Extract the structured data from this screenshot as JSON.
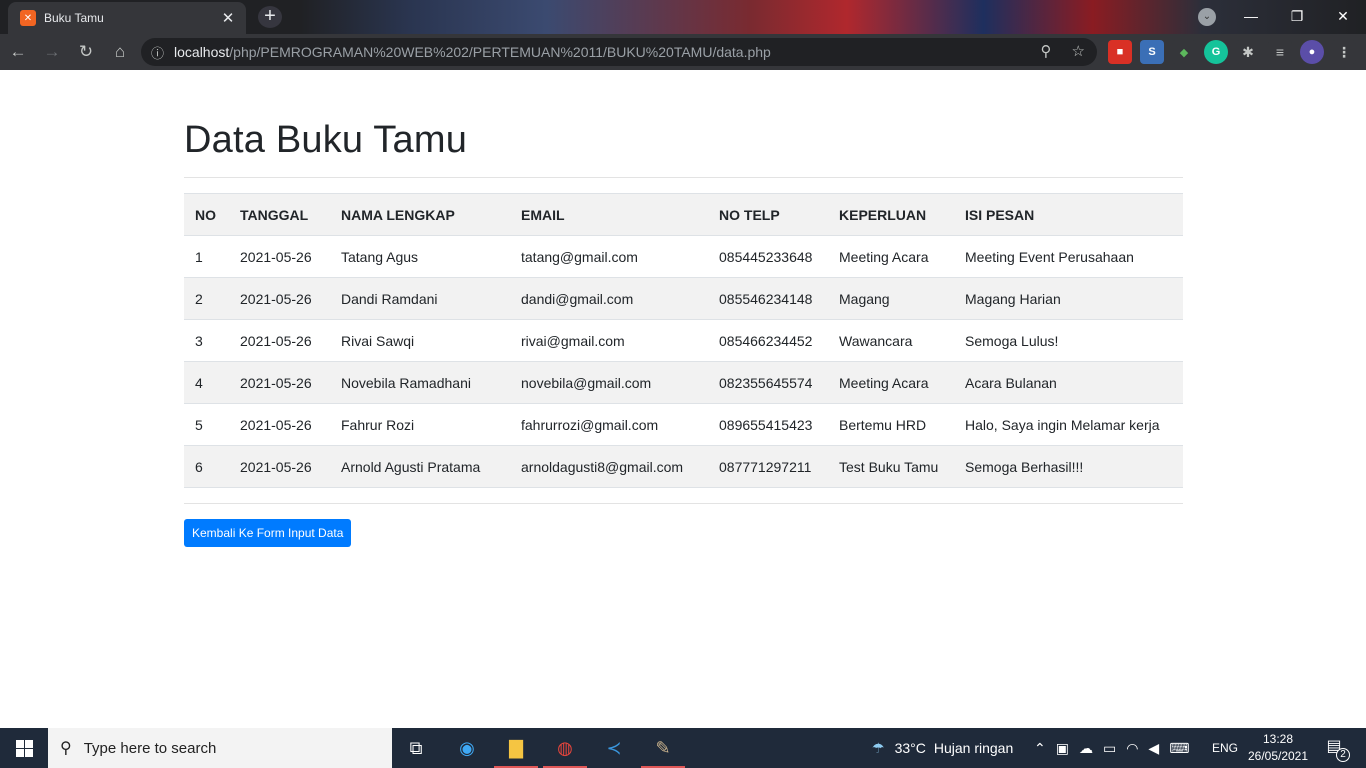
{
  "browser": {
    "tab_title": "Buku Tamu",
    "tab_close": "✕",
    "new_tab": "+",
    "url_host": "localhost",
    "url_path": "/php/PEMROGRAMAN%20WEB%202/PERTEMUAN%2011/BUKU%20TAMU/data.php",
    "window_controls": {
      "minimize": "—",
      "restore": "❐",
      "close": "✕"
    }
  },
  "page": {
    "title": "Data Buku Tamu",
    "columns": [
      "NO",
      "TANGGAL",
      "NAMA LENGKAP",
      "EMAIL",
      "NO TELP",
      "KEPERLUAN",
      "ISI PESAN"
    ],
    "rows": [
      [
        "1",
        "2021-05-26",
        "Tatang Agus",
        "tatang@gmail.com",
        "085445233648",
        "Meeting Acara",
        "Meeting Event Perusahaan"
      ],
      [
        "2",
        "2021-05-26",
        "Dandi Ramdani",
        "dandi@gmail.com",
        "085546234148",
        "Magang",
        "Magang Harian"
      ],
      [
        "3",
        "2021-05-26",
        "Rivai Sawqi",
        "rivai@gmail.com",
        "085466234452",
        "Wawancara",
        "Semoga Lulus!"
      ],
      [
        "4",
        "2021-05-26",
        "Novebila Ramadhani",
        "novebila@gmail.com",
        "082355645574",
        "Meeting Acara",
        "Acara Bulanan"
      ],
      [
        "5",
        "2021-05-26",
        "Fahrur Rozi",
        "fahrurrozi@gmail.com",
        "089655415423",
        "Bertemu HRD",
        "Halo, Saya ingin Melamar kerja"
      ],
      [
        "6",
        "2021-05-26",
        "Arnold Agusti Pratama",
        "arnoldagusti8@gmail.com",
        "087771297211",
        "Test Buku Tamu",
        "Semoga Berhasil!!!"
      ]
    ],
    "back_button": "Kembali Ke Form Input Data"
  },
  "taskbar": {
    "search_placeholder": "Type here to search",
    "weather_temp": "33°C",
    "weather_desc": "Hujan ringan",
    "language": "ENG",
    "time": "13:28",
    "date": "26/05/2021",
    "notification_count": "2"
  },
  "colors": {
    "button_bg": "#007bff",
    "tab_favicon": "#f26522",
    "taskbar_bg": "#1f2a3a"
  }
}
